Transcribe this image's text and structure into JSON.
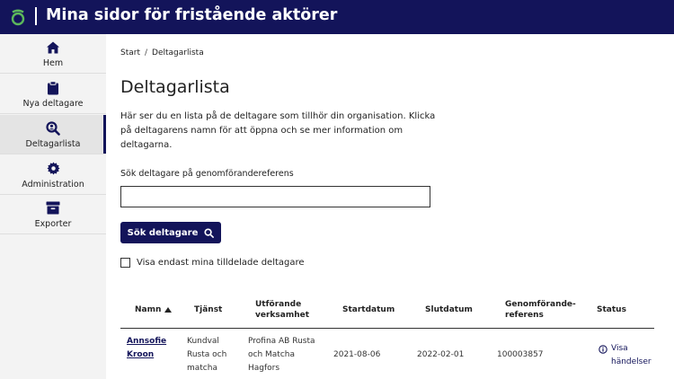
{
  "app": {
    "title": "Mina sidor för fristående aktörer"
  },
  "sidebar": {
    "items": [
      {
        "label": "Hem",
        "icon": "home-icon"
      },
      {
        "label": "Nya deltagare",
        "icon": "clipboard-icon"
      },
      {
        "label": "Deltagarlista",
        "icon": "search-person-icon"
      },
      {
        "label": "Administration",
        "icon": "gear-icon"
      },
      {
        "label": "Exporter",
        "icon": "archive-icon"
      }
    ]
  },
  "breadcrumb": {
    "start": "Start",
    "separator": "/",
    "current": "Deltagarlista"
  },
  "page": {
    "title": "Deltagarlista",
    "intro": "Här ser du en lista på de deltagare som tillhör din organisation. Klicka på deltagarens namn för att öppna och se mer information om deltagarna."
  },
  "search": {
    "label": "Sök deltagare på genomförandereferens",
    "value": "",
    "button_label": "Sök deltagare"
  },
  "filter": {
    "label": "Visa endast mina tilldelade deltagare",
    "checked": false
  },
  "table": {
    "headers": {
      "name": "Namn",
      "service": "Tjänst",
      "provider_1": "Utförande",
      "provider_2": "verksamhet",
      "start": "Startdatum",
      "end": "Slutdatum",
      "ref_1": "Genomförande-",
      "ref_2": "referens",
      "status": "Status"
    },
    "rows": [
      {
        "name_1": "Annsofie",
        "name_2": "Kroon",
        "service_1": "Kundval",
        "service_2": "Rusta och",
        "service_3": "matcha",
        "provider_1": "Profina AB Rusta",
        "provider_2": "och Matcha",
        "provider_3": "Hagfors",
        "start": "2021-08-06",
        "end": "2022-02-01",
        "ref": "100003857",
        "status_1": "Visa",
        "status_2": "händelser"
      }
    ]
  },
  "colors": {
    "brand": "#13145a",
    "logo_accent": "#5cb85c",
    "sidebar_bg": "#f3f3f3"
  }
}
